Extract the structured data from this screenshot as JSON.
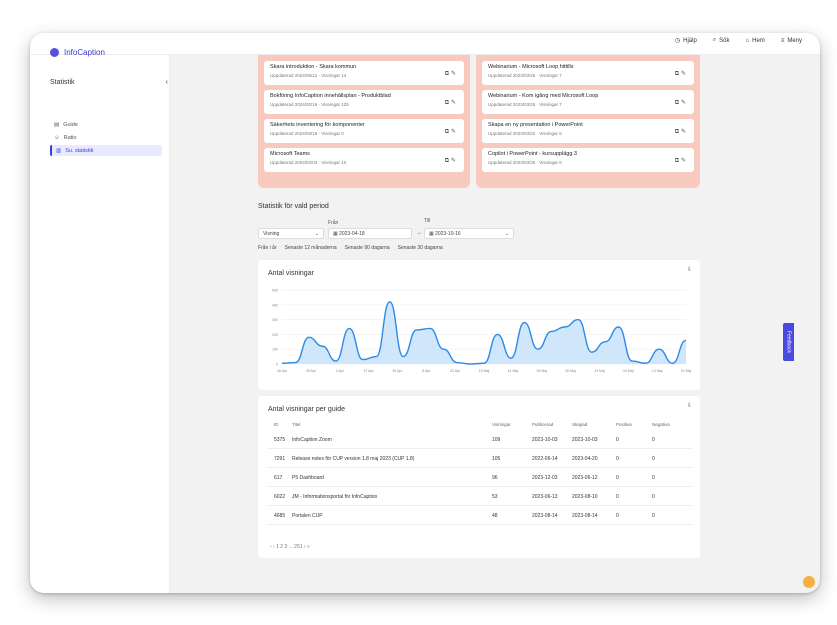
{
  "app": {
    "name": "InfoCaption"
  },
  "topnav": [
    {
      "icon": "clock-icon",
      "label": "Hjälp"
    },
    {
      "icon": "search-icon",
      "label": "Sök"
    },
    {
      "icon": "home-icon",
      "label": "Hem"
    },
    {
      "icon": "menu-icon",
      "label": "Meny"
    }
  ],
  "sidebar": {
    "title": "Statistik",
    "items": [
      {
        "icon": "guide-icon",
        "label": "Guide"
      },
      {
        "icon": "user-icon",
        "label": "Ratio"
      },
      {
        "icon": "chart-icon",
        "label": "Su. statistik"
      }
    ]
  },
  "left_column": [
    {
      "title": "Skara introduktion - Skara kommun",
      "meta": "Uppdaterad 2024/06/12 · Visningar 14"
    },
    {
      "title": "Bokföring InfoCaption innehållsplan - Produktblad",
      "meta": "Uppdaterad 2024/02/16 · Visningar 125"
    },
    {
      "title": "Säkerhets inventering för komponenter",
      "meta": "Uppdaterad 2024/03/15 · Visningar 0"
    },
    {
      "title": "Microsoft Teams",
      "meta": "Uppdaterad 2024/02/03 · Visningar 10"
    }
  ],
  "right_column": [
    {
      "title": "Webinarium - Microsoft Loop hittills",
      "meta": "Uppdaterad 2023/03/25 · Visningar 7"
    },
    {
      "title": "Webinarium - Kom igång med Microsoft Loop",
      "meta": "Uppdaterad 2023/03/25 · Visningar 7"
    },
    {
      "title": "Skapa en ny presentation i PowerPoint",
      "meta": "Uppdaterad 2023/03/22 · Visningar 6"
    },
    {
      "title": "Copilot i PowerPoint - kursupplägg 3",
      "meta": "Uppdaterad 2023/03/25 · Visningar 6"
    }
  ],
  "period": {
    "title": "Statistik för vald period",
    "type_value": "Visning",
    "from_label": "Från",
    "from_value": "2023-04-18",
    "to_label": "Till",
    "to_value": "2023-10-16",
    "arrow": "→",
    "presets": [
      "Från i år",
      "Senaste 12 månaderna",
      "Senaste 90 dagarna",
      "Senaste 30 dagarna"
    ]
  },
  "chart_panel": {
    "title": "Antal visningar",
    "download_icon": "download-icon"
  },
  "chart_data": {
    "type": "area",
    "title": "Antal visningar",
    "x": [
      "18 Apr",
      "25 Apr",
      "2 Apr",
      "17 Apr",
      "29 Apr",
      "8 Apr",
      "22 Apr",
      "13 Maj",
      "14 Maj",
      "26 Maj",
      "30 Maj",
      "13 Maj",
      "10 Maj",
      "13 Maj",
      "20 Maj"
    ],
    "y_ticks": [
      "500",
      "400",
      "300",
      "200",
      "100",
      "0"
    ],
    "ylim": [
      0,
      500
    ],
    "series": [
      {
        "values": [
          5,
          10,
          180,
          120,
          20,
          240,
          30,
          50,
          420,
          50,
          230,
          240,
          100,
          10,
          0,
          5,
          200,
          40,
          280,
          100,
          220,
          250,
          300,
          80,
          150,
          250,
          20,
          5,
          100,
          5,
          160
        ]
      }
    ],
    "color": "#2b8be6",
    "fill": "#cfe6fb"
  },
  "table_panel": {
    "title": "Antal visningar per guide",
    "download_icon": "download-icon",
    "headers": [
      "ID",
      "Titel",
      "Visningar",
      "Publicerad",
      "Skapad",
      "Positiva",
      "Negativa"
    ],
    "rows": [
      [
        "5375",
        "InfoCaption Zoom",
        "109",
        "2023-10-03",
        "2023-10-03",
        "0",
        "0"
      ],
      [
        "7291",
        "Release notes för CUP version 1.8 maj 2023 (CUP 1.8)",
        "105",
        "2022-06-14",
        "2023-04-20",
        "0",
        "0"
      ],
      [
        "617",
        "P5 Dashboard",
        "96",
        "2023-12-03",
        "2023-06-12",
        "0",
        "0"
      ],
      [
        "6022",
        "JM - Informationsportal för InfoCaption",
        "53",
        "2023-06-13",
        "2023-08-10",
        "0",
        "0"
      ],
      [
        "4685",
        "Portalen CUP",
        "48",
        "2023-08-14",
        "2023-08-14",
        "0",
        "0"
      ]
    ],
    "pager": "‹ ‹ 1 2 3 ... 251 › »"
  },
  "feedback": {
    "label": "Feedback"
  }
}
